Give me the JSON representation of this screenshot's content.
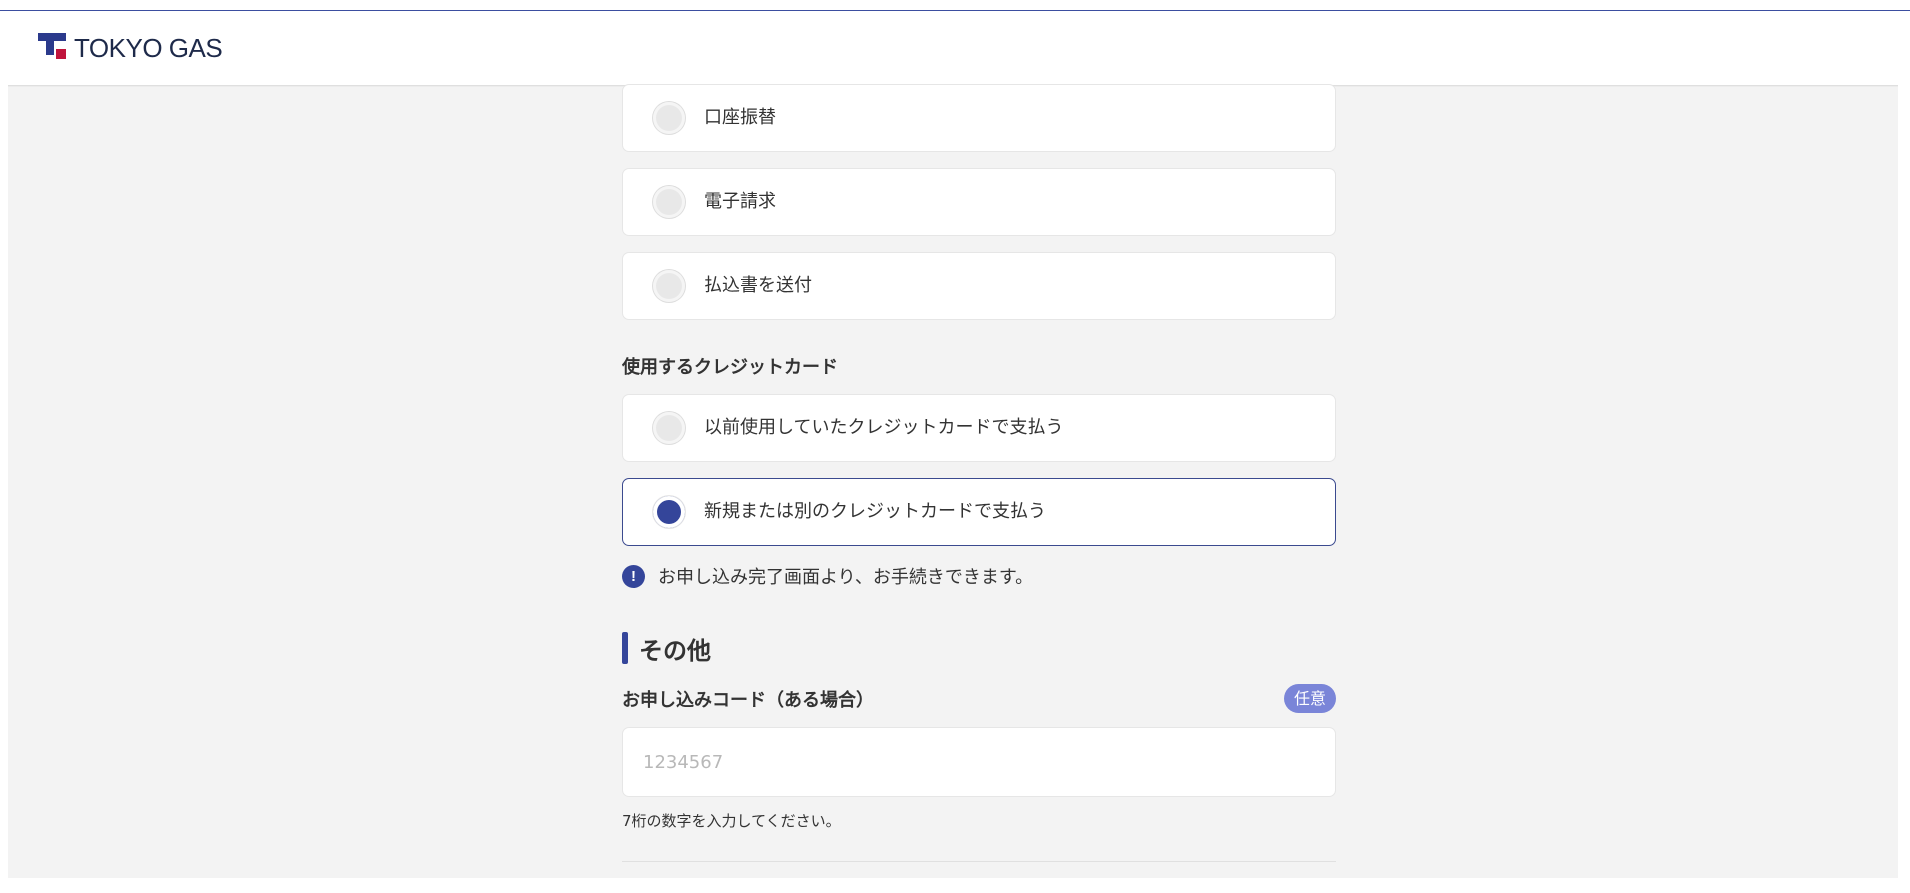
{
  "header": {
    "brand_name": "TOKYO GAS"
  },
  "payment_methods": {
    "options": [
      {
        "label": "口座振替",
        "selected": false
      },
      {
        "label": "電子請求",
        "selected": false
      },
      {
        "label": "払込書を送付",
        "selected": false
      }
    ]
  },
  "credit_card": {
    "label": "使用するクレジットカード",
    "options": [
      {
        "label": "以前使用していたクレジットカードで支払う",
        "selected": false
      },
      {
        "label": "新規または別のクレジットカードで支払う",
        "selected": true
      }
    ],
    "notice_icon": "!",
    "notice": "お申し込み完了画面より、お手続きできます。"
  },
  "other": {
    "heading": "その他",
    "code_label": "お申し込みコード（ある場合）",
    "optional_badge": "任意",
    "code_placeholder": "1234567",
    "code_help": "7桁の数字を入力してください。"
  },
  "colors": {
    "accent": "#34459a",
    "badge": "#7a85d8",
    "brand_red": "#c0143c",
    "background": "#f3f3f3"
  },
  "icons": {
    "logo": "tokyo-gas-logo-mark",
    "notice": "exclamation-circle-icon"
  }
}
